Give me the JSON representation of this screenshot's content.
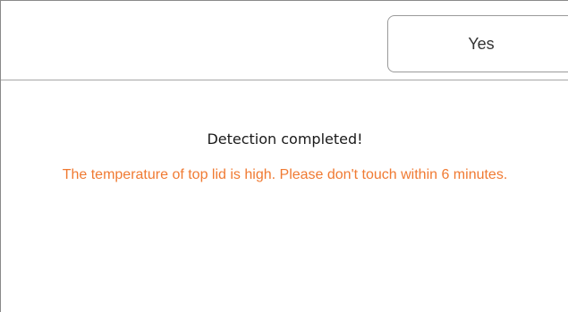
{
  "header": {
    "yes_label": "Yes"
  },
  "content": {
    "title": "Detection completed!",
    "message": "The temperature of top lid is high. Please don't touch within 6 minutes."
  },
  "colors": {
    "message": "#f07a32",
    "title": "#1a1a1a",
    "border": "#9a9a9a"
  }
}
